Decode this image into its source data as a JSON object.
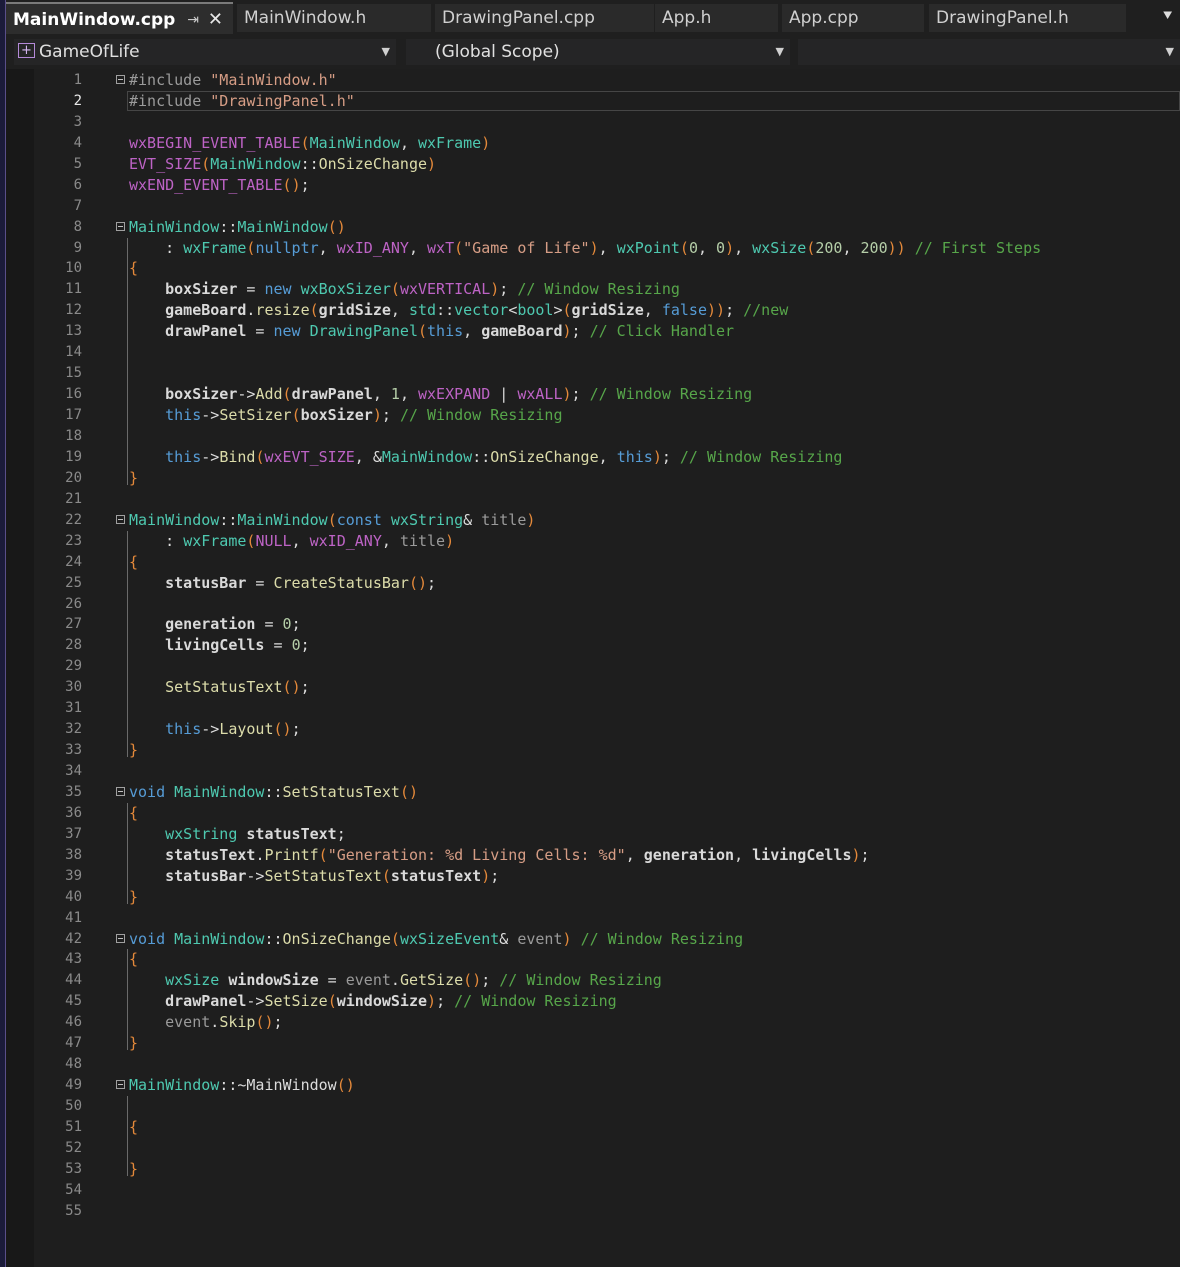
{
  "tabs": [
    {
      "label": "MainWindow.cpp",
      "active": true
    },
    {
      "label": "MainWindow.h"
    },
    {
      "label": "DrawingPanel.cpp"
    },
    {
      "label": "App.h"
    },
    {
      "label": "App.cpp"
    },
    {
      "label": "DrawingPanel.h"
    }
  ],
  "nav": {
    "project": "GameOfLife",
    "scope": "(Global Scope)",
    "member": ""
  },
  "editor": {
    "current_line": 2,
    "lines": [
      "#include \"MainWindow.h\"",
      "#include \"DrawingPanel.h\"",
      "",
      "wxBEGIN_EVENT_TABLE(MainWindow, wxFrame)",
      "EVT_SIZE(MainWindow::OnSizeChange)",
      "wxEND_EVENT_TABLE();",
      "",
      "MainWindow::MainWindow()",
      "    : wxFrame(nullptr, wxID_ANY, wxT(\"Game of Life\"), wxPoint(0, 0), wxSize(200, 200)) // First Steps",
      "{",
      "    boxSizer = new wxBoxSizer(wxVERTICAL); // Window Resizing",
      "    gameBoard.resize(gridSize, std::vector<bool>(gridSize, false)); //new",
      "    drawPanel = new DrawingPanel(this, gameBoard); // Click Handler",
      "",
      "",
      "    boxSizer->Add(drawPanel, 1, wxEXPAND | wxALL); // Window Resizing",
      "    this->SetSizer(boxSizer); // Window Resizing",
      "",
      "    this->Bind(wxEVT_SIZE, &MainWindow::OnSizeChange, this); // Window Resizing",
      "}",
      "",
      "MainWindow::MainWindow(const wxString& title)",
      "    : wxFrame(NULL, wxID_ANY, title)",
      "{",
      "    statusBar = CreateStatusBar();",
      "",
      "    generation = 0;",
      "    livingCells = 0;",
      "",
      "    SetStatusText();",
      "",
      "    this->Layout();",
      "}",
      "",
      "void MainWindow::SetStatusText()",
      "{",
      "    wxString statusText;",
      "    statusText.Printf(\"Generation: %d Living Cells: %d\", generation, livingCells);",
      "    statusBar->SetStatusText(statusText);",
      "}",
      "",
      "void MainWindow::OnSizeChange(wxSizeEvent& event) // Window Resizing",
      "{",
      "    wxSize windowSize = event.GetSize(); // Window Resizing",
      "    drawPanel->SetSize(windowSize); // Window Resizing",
      "    event.Skip();",
      "}",
      "",
      "MainWindow::~MainWindow()",
      "",
      "{",
      "",
      "}",
      "",
      ""
    ]
  }
}
